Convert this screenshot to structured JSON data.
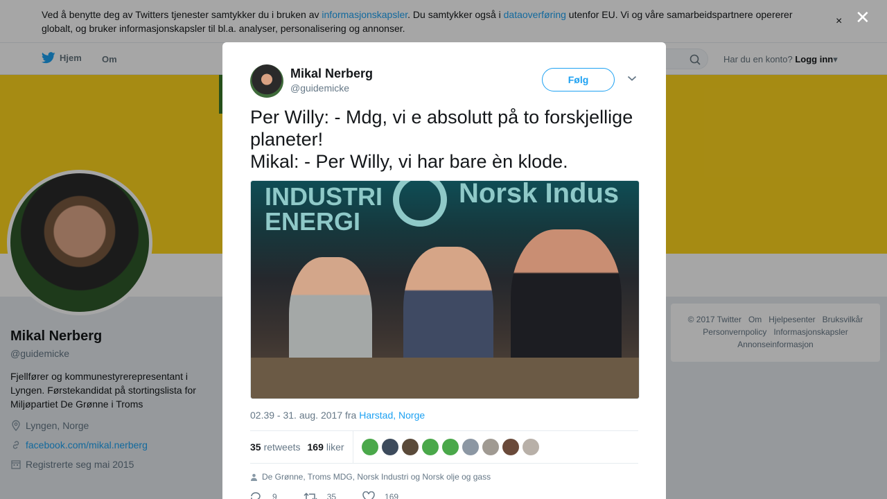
{
  "cookie": {
    "text_1": "Ved å benytte deg av Twitters tjenester samtykker du i bruken av ",
    "link_1": "informasjonskapsler",
    "text_2": ". Du samtykker også i ",
    "link_2": "dataoverføring",
    "text_3": " utenfor EU. Vi og våre samarbeidspartnere opererer globalt, og bruker informasjonskapsler til bl.a. analyser, personalisering og annonser.",
    "close_glyph": "×"
  },
  "nav": {
    "home": "Hjem",
    "about": "Om",
    "account_question": "Har du en konto?",
    "login": "Logg inn"
  },
  "profile": {
    "name": "Mikal Nerberg",
    "handle": "@guidemicke",
    "bio": "Fjellfører og kommunestyrerepresentant i Lyngen. Førstekandidat på stortingslista for Miljøpartiet De Grønne i Troms",
    "location": "Lyngen, Norge",
    "website": "facebook.com/mikal.nerberg",
    "joined": "Registrerte seg mai 2015"
  },
  "footer": {
    "items": [
      "© 2017 Twitter",
      "Om",
      "Hjelpesenter",
      "Bruksvilkår",
      "Personvernpolicy",
      "Informasjonskapsler",
      "Annonseinformasjon"
    ]
  },
  "modal": {
    "close_glyph": "✕",
    "author_name": "Mikal Nerberg",
    "author_handle": "@guidemicke",
    "follow": "Følg",
    "tweet_line_1": "Per Willy: - Mdg, vi e absolutt på to forskjellige planeter!",
    "tweet_line_2": "Mikal: - Per Willy, vi har bare èn klode.",
    "photo_logo_text": "INDUSTRI ENERGI",
    "photo_banner_text": "Norsk Indus",
    "timestamp": "02.39 - 31. aug. 2017 fra ",
    "place": "Harstad, Norge",
    "retweets_count": "35",
    "retweets_label": "retweets",
    "likes_count": "169",
    "likes_label": "liker",
    "mentions": "De Grønne, Troms MDG, Norsk Industri og Norsk olje og gass",
    "reply_count": "9",
    "retweet_count": "35",
    "like_count": "169"
  },
  "colors": {
    "accent": "#1da1f2",
    "banner": "#ffd61e"
  }
}
